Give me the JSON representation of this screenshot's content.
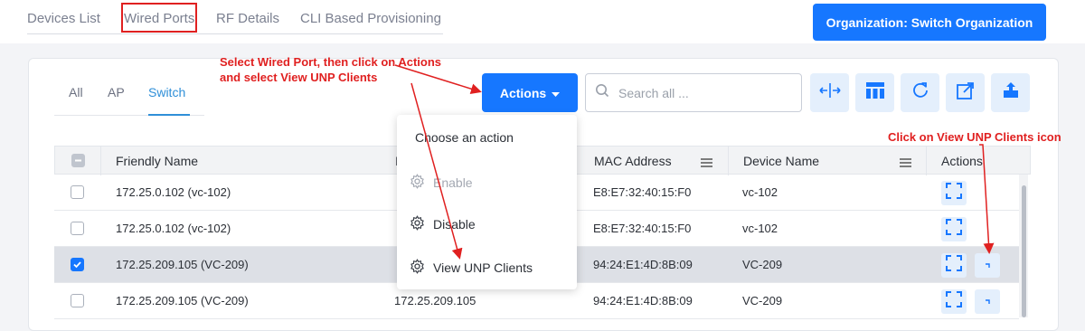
{
  "top_nav": {
    "tabs": [
      {
        "label": "Devices List"
      },
      {
        "label": "Wired Ports"
      },
      {
        "label": "RF Details"
      },
      {
        "label": "CLI Based Provisioning"
      }
    ],
    "org_button": "Organization: Switch Organization"
  },
  "sub_tabs": [
    {
      "label": "All"
    },
    {
      "label": "AP"
    },
    {
      "label": "Switch"
    }
  ],
  "toolbar": {
    "actions_label": "Actions",
    "search_placeholder": "Search all ...",
    "tool_icons": [
      "split-columns-icon",
      "column-layout-icon",
      "refresh-icon",
      "export-icon",
      "upload-icon"
    ]
  },
  "table": {
    "columns": [
      "Friendly Name",
      "I",
      "MAC Address",
      "Device Name",
      "Actions"
    ],
    "rows": [
      {
        "friendly_name": "172.25.0.102 (vc-102)",
        "ip": "",
        "mac": "E8:E7:32:40:15:F0",
        "device_name": "vc-102",
        "selected": false
      },
      {
        "friendly_name": "172.25.0.102 (vc-102)",
        "ip": "",
        "mac": "E8:E7:32:40:15:F0",
        "device_name": "vc-102",
        "selected": false
      },
      {
        "friendly_name": "172.25.209.105 (VC-209)",
        "ip": "",
        "mac": "94:24:E1:4D:8B:09",
        "device_name": "VC-209",
        "selected": true
      },
      {
        "friendly_name": "172.25.209.105 (VC-209)",
        "ip": "172.25.209.105",
        "mac": "94:24:E1:4D:8B:09",
        "device_name": "VC-209",
        "selected": false
      }
    ]
  },
  "dropdown": {
    "title": "Choose an action",
    "items": [
      {
        "label": "Enable",
        "disabled": true
      },
      {
        "label": "Disable",
        "disabled": false
      },
      {
        "label": "View UNP Clients",
        "disabled": false
      }
    ]
  },
  "annotations": {
    "note1_line1": "Select Wired Port, then click on Actions",
    "note1_line2": "and select View UNP Clients",
    "note2": "Click on View UNP Clients icon"
  },
  "colors": {
    "primary": "#1677ff",
    "annotation": "#e02020",
    "active_tab": "#2f8fd8"
  }
}
